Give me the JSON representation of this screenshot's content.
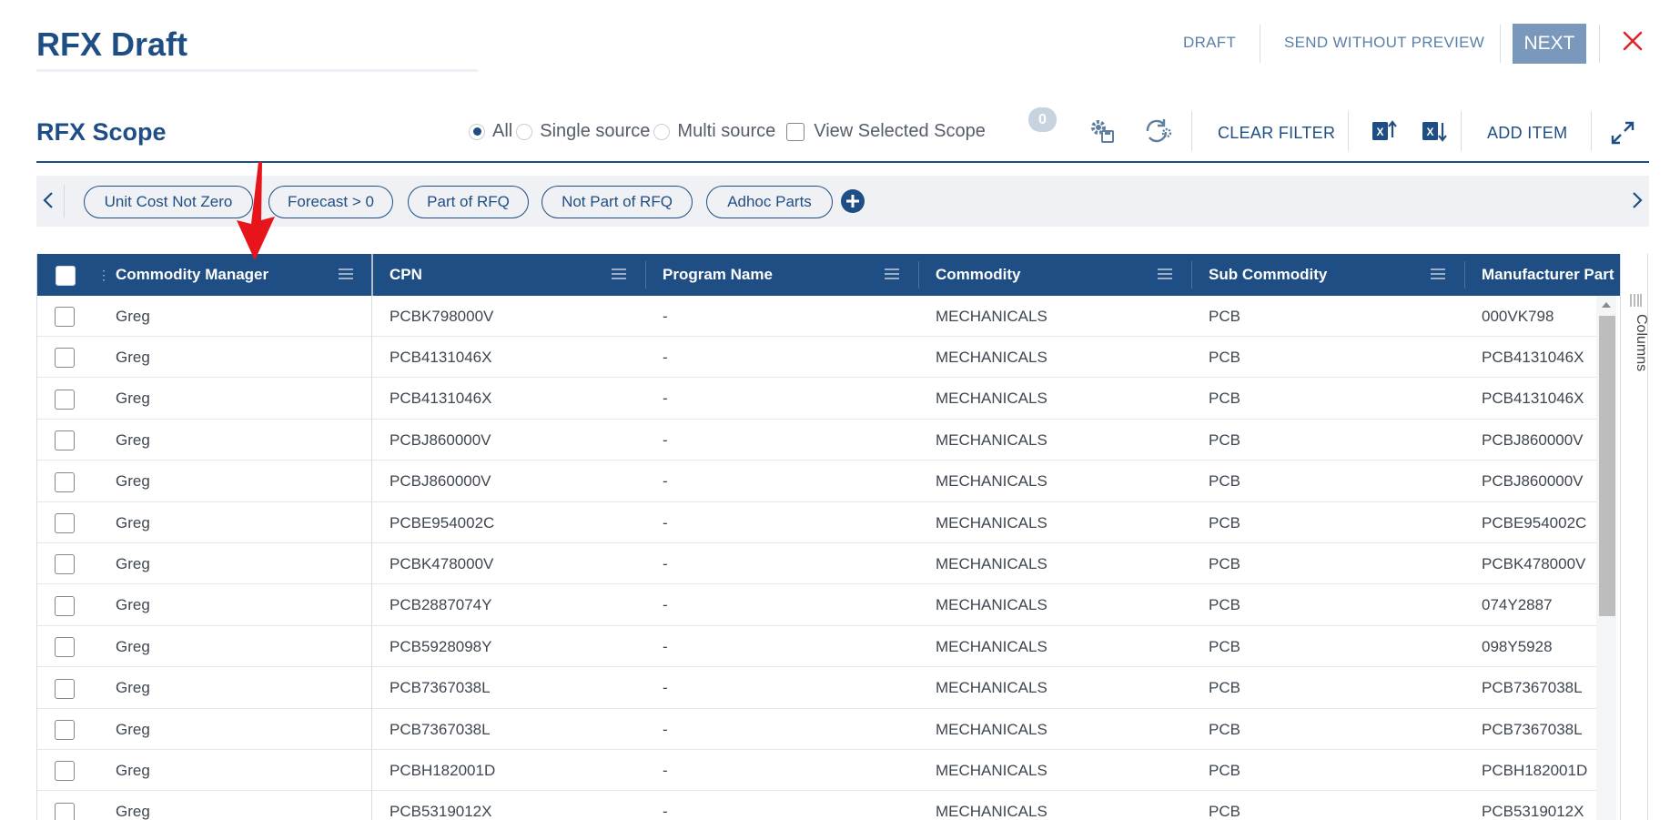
{
  "header": {
    "title": "RFX Draft",
    "draft_label": "DRAFT",
    "send_label": "SEND WITHOUT PREVIEW",
    "next_label": "NEXT",
    "close_icon": "close-icon"
  },
  "scope": {
    "title": "RFX Scope",
    "radio_options": [
      {
        "label": "All",
        "selected": true
      },
      {
        "label": "Single source",
        "selected": false
      },
      {
        "label": "Multi source",
        "selected": false
      }
    ],
    "view_selected_label": "View Selected Scope",
    "view_selected_checked": false,
    "selected_count": "0",
    "clear_filter_label": "CLEAR FILTER",
    "add_item_label": "ADD ITEM",
    "icons": [
      "settings-save-icon",
      "refresh-settings-icon",
      "excel-upload-icon",
      "excel-download-icon",
      "expand-icon"
    ]
  },
  "filters": {
    "chips": [
      "Unit Cost Not Zero",
      "Forecast > 0",
      "Part of RFQ",
      "Not Part of RFQ",
      "Adhoc Parts"
    ]
  },
  "grid": {
    "columns": [
      "Commodity Manager",
      "CPN",
      "Program Name",
      "Commodity",
      "Sub Commodity",
      "Manufacturer Part"
    ],
    "rows": [
      [
        "Greg",
        "PCBK798000V",
        "-",
        "MECHANICALS",
        "PCB",
        "000VK798"
      ],
      [
        "Greg",
        "PCB4131046X",
        "-",
        "MECHANICALS",
        "PCB",
        "PCB4131046X"
      ],
      [
        "Greg",
        "PCB4131046X",
        "-",
        "MECHANICALS",
        "PCB",
        "PCB4131046X"
      ],
      [
        "Greg",
        "PCBJ860000V",
        "-",
        "MECHANICALS",
        "PCB",
        "PCBJ860000V"
      ],
      [
        "Greg",
        "PCBJ860000V",
        "-",
        "MECHANICALS",
        "PCB",
        "PCBJ860000V"
      ],
      [
        "Greg",
        "PCBE954002C",
        "-",
        "MECHANICALS",
        "PCB",
        "PCBE954002C"
      ],
      [
        "Greg",
        "PCBK478000V",
        "-",
        "MECHANICALS",
        "PCB",
        "PCBK478000V"
      ],
      [
        "Greg",
        "PCB2887074Y",
        "-",
        "MECHANICALS",
        "PCB",
        "074Y2887"
      ],
      [
        "Greg",
        "PCB5928098Y",
        "-",
        "MECHANICALS",
        "PCB",
        "098Y5928"
      ],
      [
        "Greg",
        "PCB7367038L",
        "-",
        "MECHANICALS",
        "PCB",
        "PCB7367038L"
      ],
      [
        "Greg",
        "PCB7367038L",
        "-",
        "MECHANICALS",
        "PCB",
        "PCB7367038L"
      ],
      [
        "Greg",
        "PCBH182001D",
        "-",
        "MECHANICALS",
        "PCB",
        "PCBH182001D"
      ],
      [
        "Greg",
        "PCB5319012X",
        "-",
        "MECHANICALS",
        "PCB",
        "PCB5319012X"
      ]
    ],
    "side_panel_label": "Columns"
  },
  "colors": {
    "primary": "#1f4e85",
    "next_button": "#7a97bc",
    "close": "#e0262b",
    "annotation_arrow": "#e8141b"
  }
}
